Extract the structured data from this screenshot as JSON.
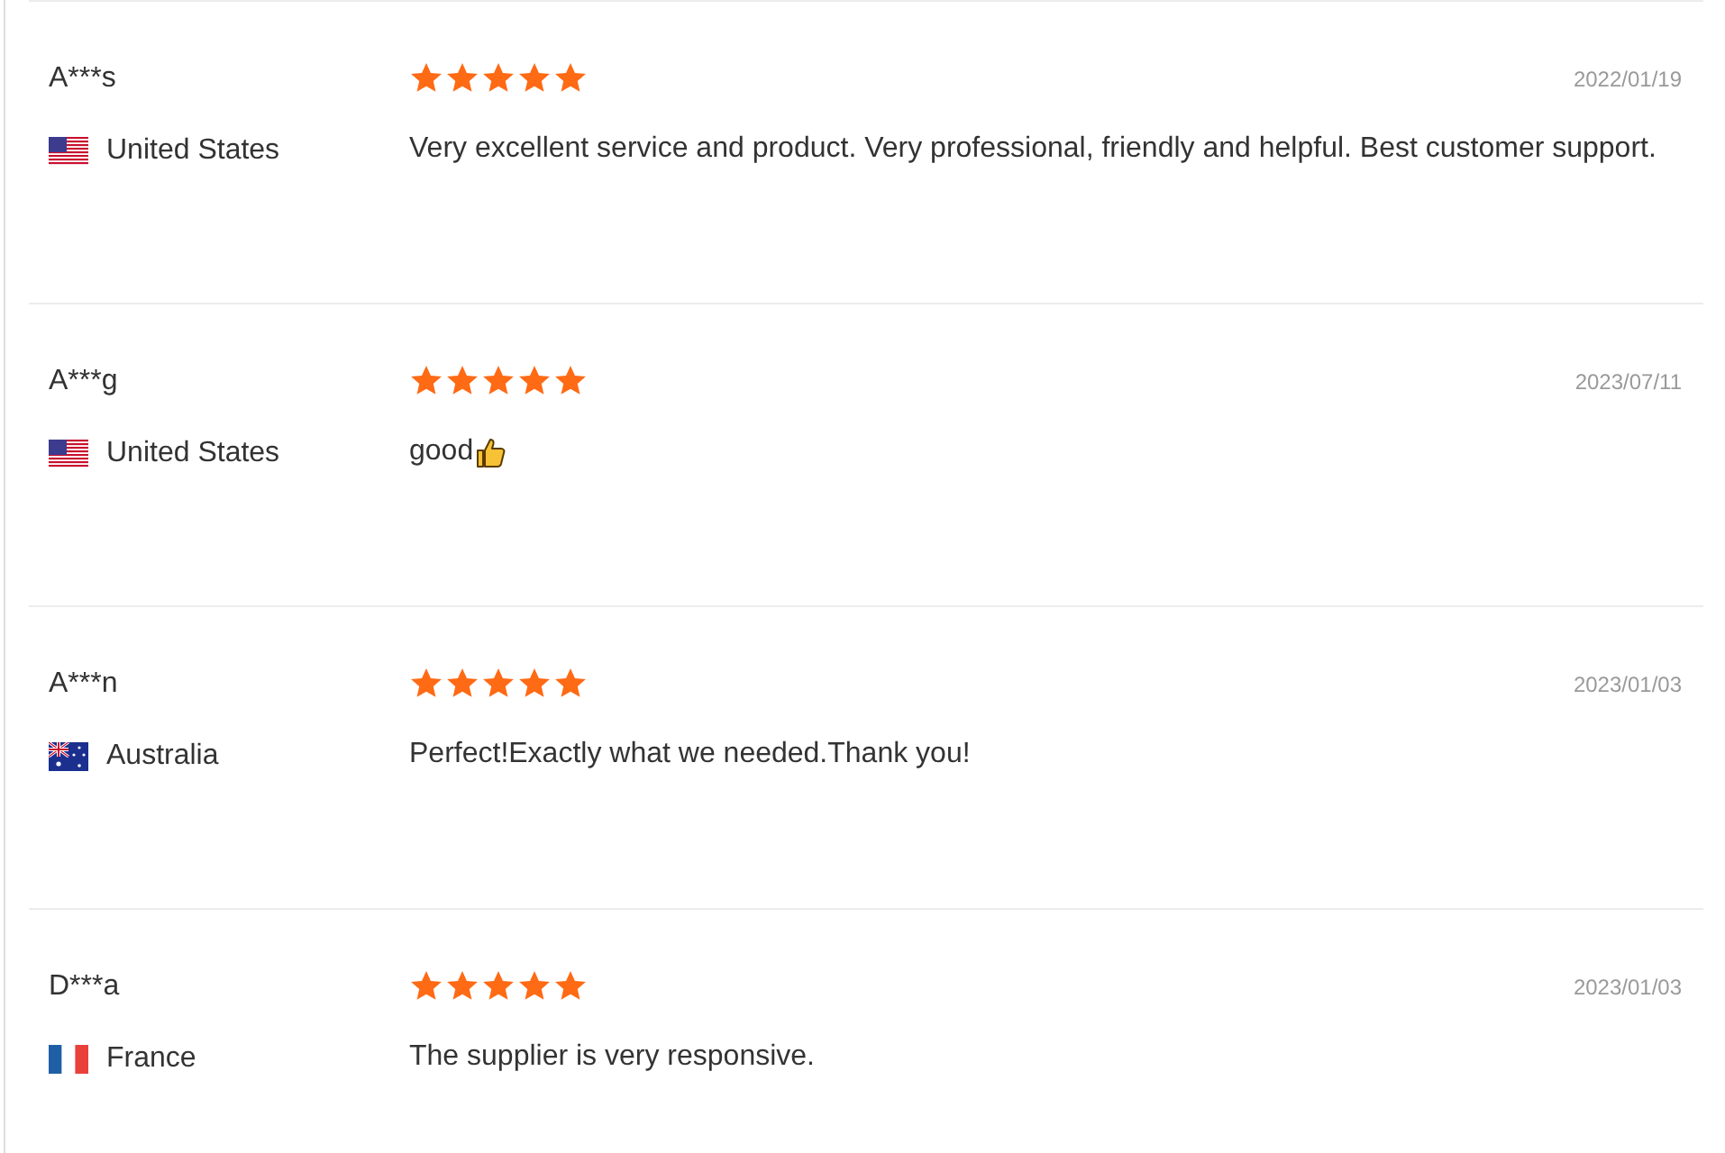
{
  "reviews": [
    {
      "name": "A***s",
      "kind": "us",
      "country": "United States",
      "stars": 5,
      "date": "2022/01/19",
      "comment": "Very excellent service and product. Very professional, friendly and helpful. Best customer support."
    },
    {
      "name": "A***g",
      "kind": "us",
      "country": "United States",
      "stars": 5,
      "date": "2023/07/11",
      "comment": "good",
      "thumbs_up": true
    },
    {
      "name": "A***n",
      "kind": "au",
      "country": "Australia",
      "stars": 5,
      "date": "2023/01/03",
      "comment": "Perfect!Exactly what we needed.Thank you!"
    },
    {
      "name": "D***a",
      "kind": "fr",
      "country": "France",
      "stars": 5,
      "date": "2023/01/03",
      "comment": "The supplier is very responsive."
    }
  ]
}
